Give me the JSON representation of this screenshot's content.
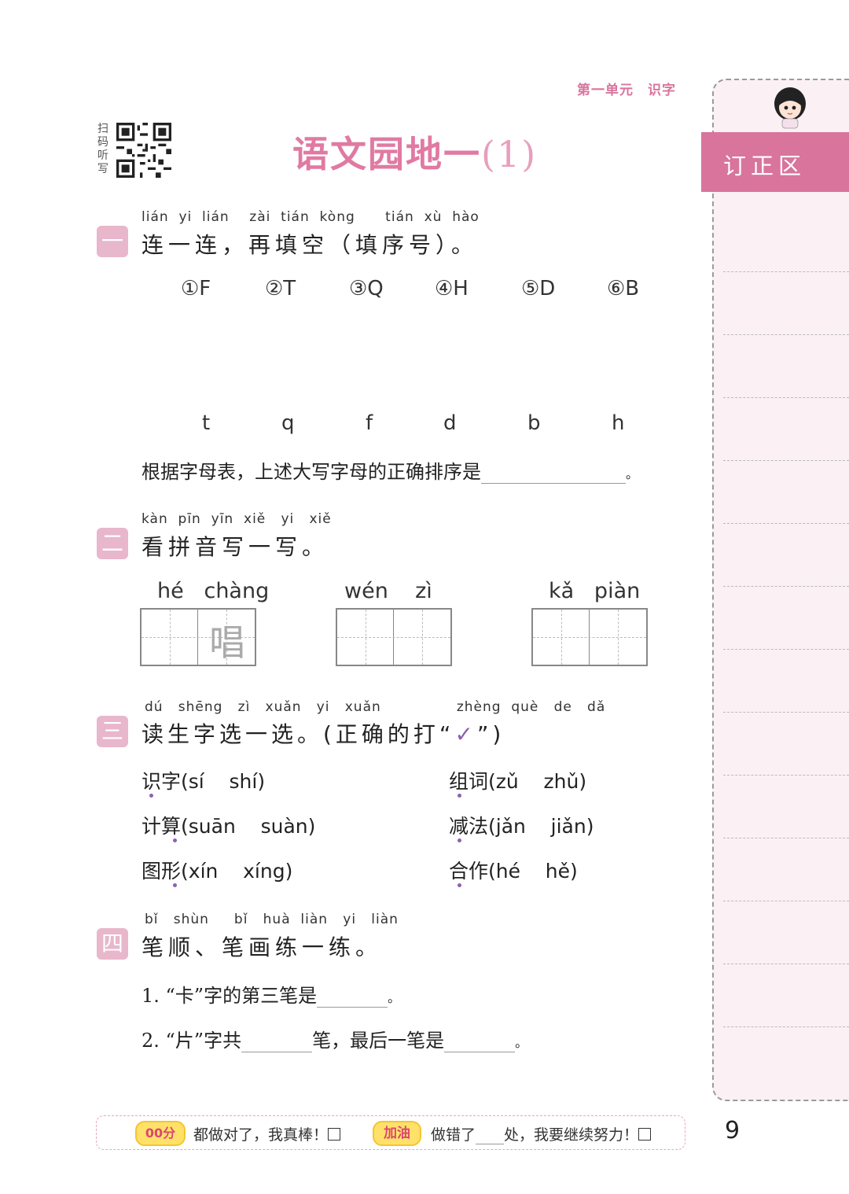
{
  "header": {
    "unit": "第一单元　识字"
  },
  "scan": {
    "label": "扫码听写"
  },
  "title": {
    "main": "语文园地一",
    "part": "(1)"
  },
  "sidebar": {
    "tab_label": "订正区"
  },
  "section1": {
    "badge": "一",
    "pinyin": "lián  yi  lián    zài  tián  kòng      tián  xù  hào",
    "title": "连一连，再填空（填序号）。",
    "uppercase": [
      "①F",
      "②T",
      "③Q",
      "④H",
      "⑤D",
      "⑥B"
    ],
    "lowercase": [
      "t",
      "q",
      "f",
      "d",
      "b",
      "h"
    ],
    "question": "根据字母表，上述大写字母的正确排序是",
    "end": "。"
  },
  "section2": {
    "badge": "二",
    "pinyin": "kàn  pīn  yīn  xiě   yi   xiě",
    "title": "看拼音写一写。",
    "items": [
      {
        "pinyin": "hé   chàng",
        "trace": "唱"
      },
      {
        "pinyin": "wén    zì",
        "trace": ""
      },
      {
        "pinyin": "kǎ   piàn",
        "trace": ""
      }
    ]
  },
  "section3": {
    "badge": "三",
    "pinyin": "dú   shēng   zì   xuǎn   yi   xuǎn               zhèng  què   de   dǎ",
    "title": "读生字选一选。(正确的打“",
    "title_end": "”)",
    "check": "✓",
    "items": [
      {
        "hanzi": "识字",
        "options": "(sí    shí)"
      },
      {
        "hanzi": "组词",
        "options": "(zǔ    zhǔ)"
      },
      {
        "hanzi": "计算",
        "options": "(suān    suàn)"
      },
      {
        "hanzi": "减法",
        "options": "(jǎn    jiǎn)"
      },
      {
        "hanzi": "图形",
        "options": "(xín    xíng)"
      },
      {
        "hanzi": "合作",
        "options": "(hé    hě)"
      }
    ]
  },
  "section4": {
    "badge": "四",
    "pinyin": "bǐ   shùn     bǐ   huà  liàn   yi   liàn",
    "title": "笔顺、笔画练一练。",
    "q1_prefix": "1. “卡”字的第三笔是",
    "q1_end": "。",
    "q2_prefix": "2. “片”字共",
    "q2_mid": "笔，最后一笔是",
    "q2_end": "。"
  },
  "footer": {
    "badge1": "00分",
    "text1": "都做对了，我真棒！",
    "badge2": "加油",
    "text2a": "做错了",
    "text2b": "处，我要继续努力！"
  },
  "page_number": "9",
  "colors": {
    "accent": "#d9749c",
    "badge": "#e8b7cb",
    "check": "#8e5fb0"
  }
}
